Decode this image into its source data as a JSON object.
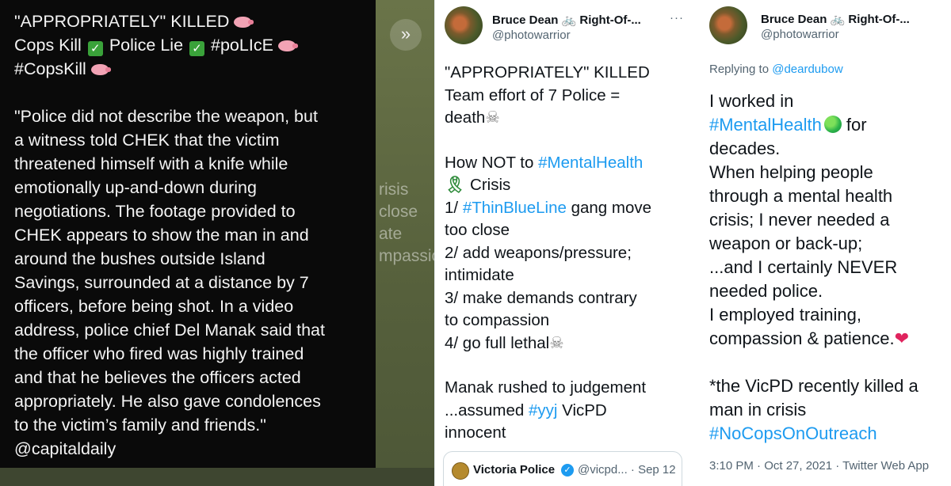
{
  "left_card": {
    "forward_icon": "double-chevron-right-icon",
    "line1": "\"APPROPRIATELY\" KILLED",
    "line2_a": "Cops Kill",
    "line2_b": "Police Lie",
    "line2_c": "#poLIcE",
    "line3": "#CopsKill",
    "quote_lines": [
      "\"Police did not describe the weapon, but",
      "a witness told CHEK that the victim",
      "threatened himself with a knife while",
      "emotionally up-and-down during",
      "negotiations. The footage provided to",
      "CHEK appears to show the man in and",
      "around the bushes outside Island",
      "Savings, surrounded at a distance by 7",
      "officers, before being shot. In a video",
      "address, police chief Del Manak said that",
      "the officer who fired was highly trained",
      "and that he believes the officers acted",
      "appropriately. He also gave condolences",
      "to the victim’s family and friends.\""
    ],
    "source": "@capitaldaily",
    "background_fragments": "risis\nclose\nate\nmpassio"
  },
  "tweet1": {
    "name": "Bruce Dean 🚲 Right-Of-...",
    "handle": "@photowarrior",
    "more": "···",
    "l1": "\"APPROPRIATELY\" KILLED",
    "l2": "Team effort of 7 Police =",
    "l3": "death",
    "l4_a": "How NOT to",
    "l4_tag": "#MentalHealth",
    "l5_ribbon": "🎗",
    "l5": "Crisis",
    "l6_a": "1/",
    "l6_tag": "#ThinBlueLine",
    "l6_b": "gang move",
    "l7": "too close",
    "l8": "2/ add weapons/pressure;",
    "l9": "intimidate",
    "l10": "3/ make demands contrary",
    "l11": "to compassion",
    "l12": "4/ go full lethal",
    "l13": "Manak rushed to judgement",
    "l14_a": "...assumed",
    "l14_tag": "#yyj",
    "l14_b": "VicPD",
    "l15": "innocent",
    "skull": "☠",
    "quoted": {
      "name": "Victoria Police",
      "verified_icon": "verified-badge-icon",
      "handle": "@vicpd... · Sep 12"
    }
  },
  "tweet2": {
    "name": "Bruce Dean 🚲 Right-Of-...",
    "handle": "@photowarrior",
    "replying_label": "Replying to",
    "replying_to": "@deardubow",
    "l1": "I worked in",
    "l2_tag": "#MentalHealth",
    "l2_b": "for",
    "l3": "decades.",
    "l4": "When helping people",
    "l5": "through a mental health",
    "l6": "crisis; I never needed a",
    "l7": "weapon or back-up;",
    "l8": "...and I certainly NEVER",
    "l9": "needed police.",
    "l10": "I employed training,",
    "l11": "compassion & patience.",
    "heart": "❤",
    "l12": "*the VicPD recently killed a",
    "l13": "man in crisis",
    "l14_tag": "#NoCopsOnOutreach",
    "meta": "3:10 PM · Oct 27, 2021 · Twitter Web App"
  },
  "colors": {
    "hashtag": "#1d9bf0",
    "card_bg": "#0a0a0a",
    "heart": "#e0245e"
  }
}
